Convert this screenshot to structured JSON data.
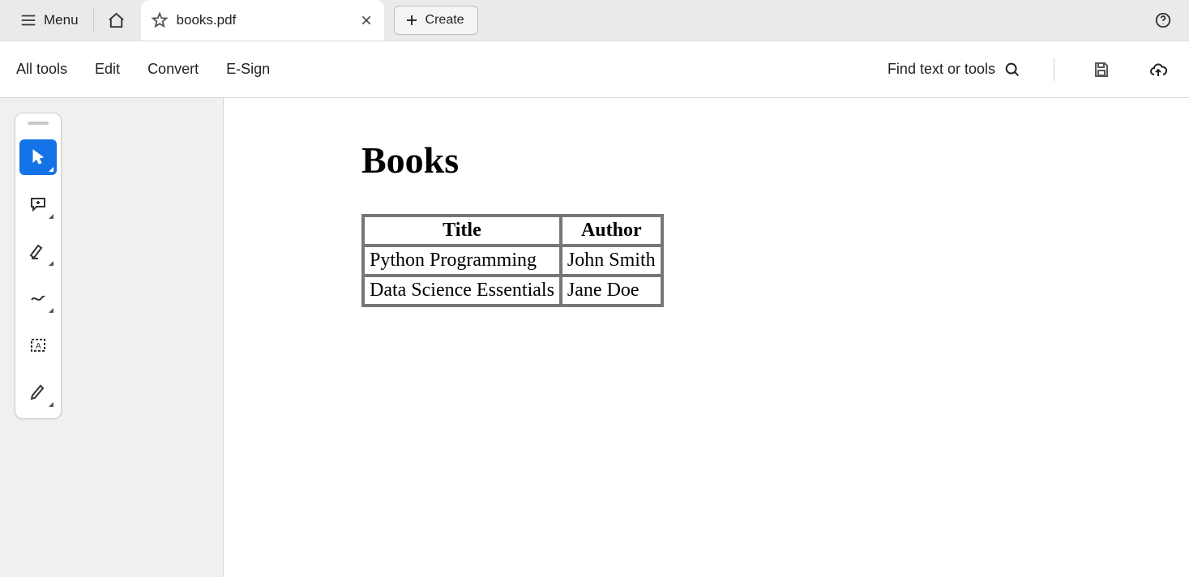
{
  "titlebar": {
    "menu_label": "Menu",
    "tab_title": "books.pdf",
    "create_label": "Create"
  },
  "toolbar": {
    "items": [
      "All tools",
      "Edit",
      "Convert",
      "E-Sign"
    ],
    "find_label": "Find text or tools"
  },
  "document": {
    "heading": "Books",
    "columns": [
      "Title",
      "Author"
    ],
    "rows": [
      {
        "title": "Python Programming",
        "author": "John Smith"
      },
      {
        "title": "Data Science Essentials",
        "author": "Jane Doe"
      }
    ]
  }
}
